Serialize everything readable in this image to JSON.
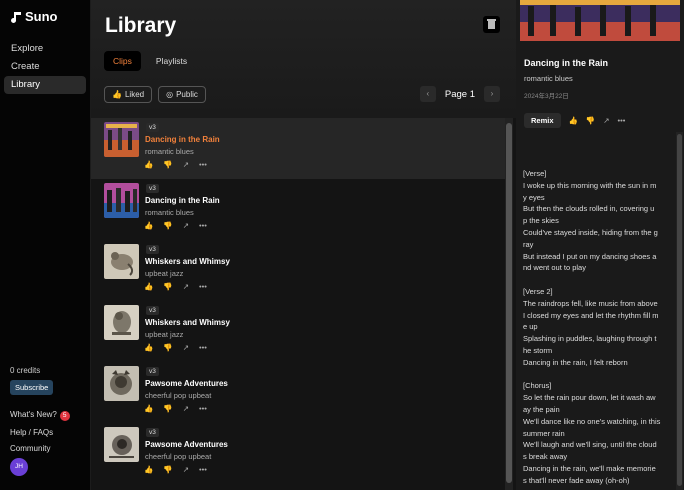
{
  "brand": "Suno",
  "sidebar": {
    "items": [
      {
        "label": "Explore"
      },
      {
        "label": "Create"
      },
      {
        "label": "Library"
      }
    ],
    "credits": "0 credits",
    "subscribe": "Subscribe",
    "whats_new": "What's New?",
    "whats_new_count": "5",
    "help": "Help / FAQs",
    "community": "Community",
    "avatar": "JH"
  },
  "main": {
    "title": "Library",
    "tabs": [
      "Clips",
      "Playlists"
    ],
    "filters": [
      "Liked",
      "Public"
    ],
    "page": "Page 1"
  },
  "clips": [
    {
      "version": "v3",
      "title": "Dancing in the Rain",
      "genre": "romantic blues",
      "active": true
    },
    {
      "version": "v3",
      "title": "Dancing in the Rain",
      "genre": "romantic blues"
    },
    {
      "version": "v3",
      "title": "Whiskers and Whimsy",
      "genre": "upbeat jazz"
    },
    {
      "version": "v3",
      "title": "Whiskers and Whimsy",
      "genre": "upbeat jazz"
    },
    {
      "version": "v3",
      "title": "Pawsome Adventures",
      "genre": "cheerful pop upbeat"
    },
    {
      "version": "v3",
      "title": "Pawsome Adventures",
      "genre": "cheerful pop upbeat"
    }
  ],
  "detail": {
    "title": "Dancing in the Rain",
    "genre": "romantic blues",
    "date": "2024年3月22日",
    "remix": "Remix",
    "lyrics": "[Verse]\nI woke up this morning with the sun in m\ny eyes\nBut then the clouds rolled in, covering u\np the skies\nCould've stayed inside, hiding from the g\nray\nBut instead I put on my dancing shoes a\nnd went out to play\n\n[Verse 2]\nThe raindrops fell, like music from above\nI closed my eyes and let the rhythm fill m\ne up\nSplashing in puddles, laughing through t\nhe storm\nDancing in the rain, I felt reborn\n\n[Chorus]\nSo let the rain pour down, let it wash aw\nay the pain\nWe'll dance like no one's watching, in this\nsummer rain\nWe'll laugh and we'll sing, until the cloud\ns break away\nDancing in the rain, we'll make memorie\ns that'll never fade away (oh-oh)"
  },
  "colors": {
    "accent": "#f2813b",
    "badge": "#e0343f",
    "subscribe": "#26445e",
    "avatar": "#6a3fd6"
  }
}
